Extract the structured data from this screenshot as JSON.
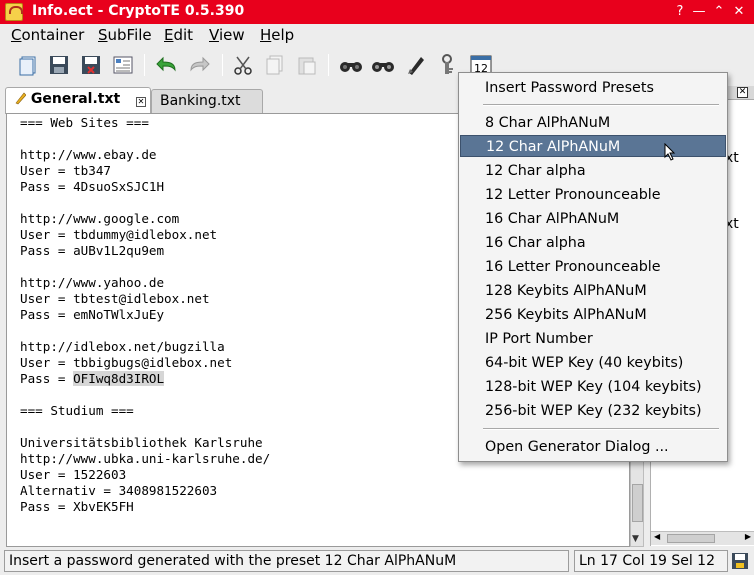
{
  "window": {
    "title": "Info.ect - CryptoTE 0.5.390"
  },
  "menu": [
    {
      "u": "C",
      "rest": "ontainer"
    },
    {
      "u": "S",
      "rest": "ubFile"
    },
    {
      "u": "E",
      "rest": "dit"
    },
    {
      "u": "V",
      "rest": "iew"
    },
    {
      "u": "H",
      "rest": "elp"
    }
  ],
  "toolbar_icons": [
    "open-icon",
    "save-icon",
    "save-as-icon",
    "properties-icon",
    "undo-icon",
    "redo-icon",
    "cut-icon",
    "copy-icon",
    "paste-icon",
    "find-icon",
    "find-next-icon",
    "goto-icon",
    "password-presets-icon",
    "insert-date-icon"
  ],
  "toolbar_calendar_day": "12",
  "tabs": [
    {
      "label": "General.txt",
      "active": true
    },
    {
      "label": "Banking.txt",
      "active": false
    }
  ],
  "editor": {
    "lines": [
      "=== Web Sites ===",
      "",
      "http://www.ebay.de",
      "User = tb347",
      "Pass = 4DsuoSxSJC1H",
      "",
      "http://www.google.com",
      "User = tbdummy@idlebox.net",
      "Pass = aUBv1L2qu9em",
      "",
      "http://www.yahoo.de",
      "User = tbtest@idlebox.net",
      "Pass = emNoTWlxJuEy",
      "",
      "http://idlebox.net/bugzilla",
      "User = tbbigbugs@idlebox.net",
      "Pass = ",
      "",
      "=== Studium ===",
      "",
      "Universitätsbibliothek Karlsruhe",
      "http://www.ubka.uni-karlsruhe.de/",
      "User = 1522603",
      "Alternativ = 3408981522603",
      "Pass = XbvEK5FH"
    ],
    "selected_text": "OFIwq8d3IROL"
  },
  "right_pane": {
    "fragments": [
      "xt",
      "xt"
    ]
  },
  "popup": {
    "header": "Insert Password Presets",
    "items": [
      "8 Char AlPhANuM",
      "12 Char AlPhANuM",
      "12 Char alpha",
      "12 Letter Pronounceable",
      "16 Char AlPhANuM",
      "16 Char alpha",
      "16 Letter Pronounceable",
      "128 Keybits AlPhANuM",
      "256 Keybits AlPhANuM",
      "IP Port Number",
      "64-bit WEP Key (40 keybits)",
      "128-bit WEP Key (104 keybits)",
      "256-bit WEP Key (232 keybits)"
    ],
    "highlighted_item": "12 Char AlPhANuM",
    "footer": "Open Generator Dialog ..."
  },
  "status": {
    "message": "Insert a password generated with the preset 12 Char AlPhANuM",
    "position": "Ln 17 Col 19 Sel 12"
  },
  "colors": {
    "titlebar": "#e8001c",
    "highlight": "#5a7595"
  }
}
